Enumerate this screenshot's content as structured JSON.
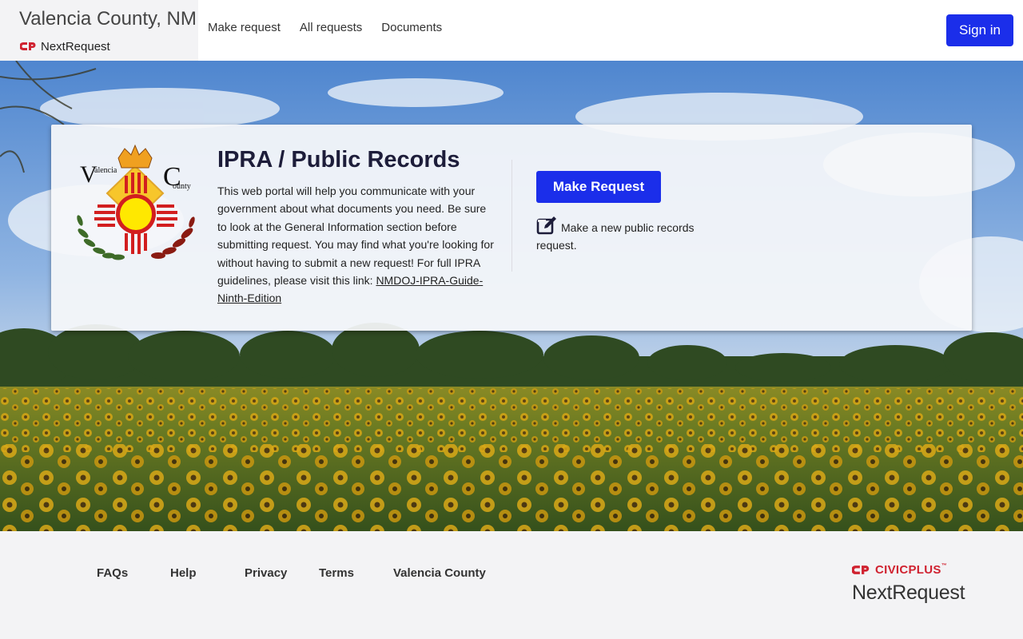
{
  "header": {
    "org_name": "Valencia County, NM",
    "product_name": "NextRequest",
    "nav": [
      {
        "label": "Make request"
      },
      {
        "label": "All requests"
      },
      {
        "label": "Documents"
      }
    ],
    "sign_in_label": "Sign in"
  },
  "seal": {
    "letters": [
      "V",
      "alencia",
      "C",
      "ounty"
    ],
    "icon": "valencia-county-seal"
  },
  "hero": {
    "title": "IPRA / Public Records",
    "description": "This web portal will help you communicate with your government about what documents you need. Be sure to look at the General Information section before submitting request. You may find what you're looking for without having to submit a new request! For full IPRA guidelines, please visit this link: ",
    "link_text": "NMDOJ-IPRA-Guide-Ninth-Edition",
    "button_label": "Make Request",
    "button_note": "Make a new public records request.",
    "note_icon": "edit-icon"
  },
  "footer": {
    "links": [
      {
        "label": "FAQs"
      },
      {
        "label": "Help"
      },
      {
        "label": "Privacy"
      },
      {
        "label": "Terms"
      },
      {
        "label": "Valencia County"
      }
    ],
    "brand_top": "CIVICPLUS",
    "brand_bottom": "NextRequest"
  },
  "colors": {
    "primary": "#1b2eea",
    "brand_red": "#d02230",
    "title": "#1d1d3a"
  }
}
